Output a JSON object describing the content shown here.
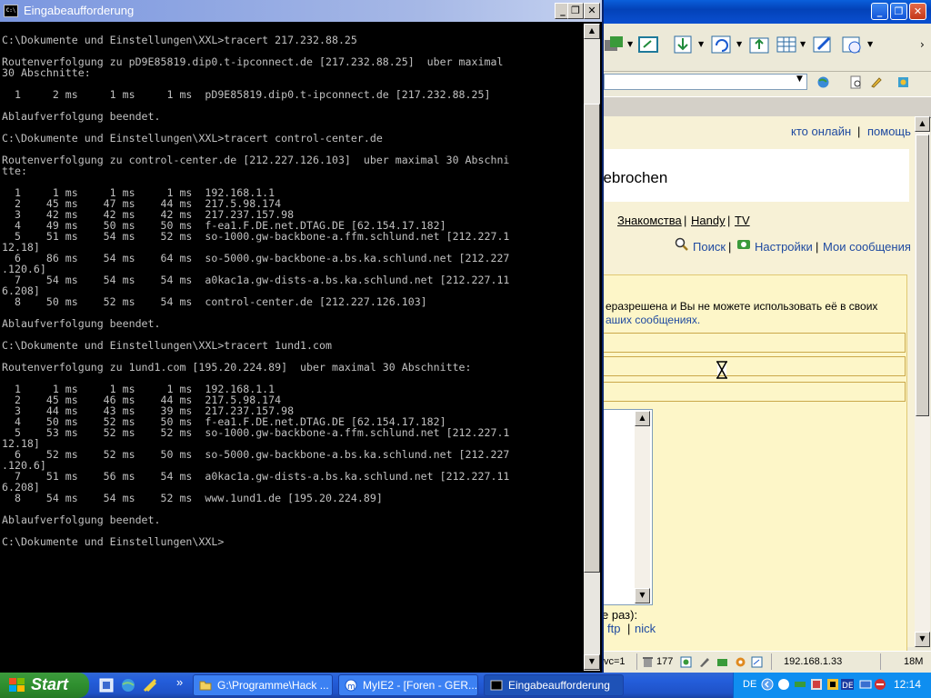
{
  "console": {
    "title": "Eingabeaufforderung",
    "output": "C:\\Dokumente und Einstellungen\\XXL>tracert 217.232.88.25\n\nRoutenverfolgung zu pD9E85819.dip0.t-ipconnect.de [217.232.88.25]  uber maximal\n30 Abschnitte:\n\n  1     2 ms     1 ms     1 ms  pD9E85819.dip0.t-ipconnect.de [217.232.88.25]\n\nAblaufverfolgung beendet.\n\nC:\\Dokumente und Einstellungen\\XXL>tracert control-center.de\n\nRoutenverfolgung zu control-center.de [212.227.126.103]  uber maximal 30 Abschni\ntte:\n\n  1     1 ms     1 ms     1 ms  192.168.1.1\n  2    45 ms    47 ms    44 ms  217.5.98.174\n  3    42 ms    42 ms    42 ms  217.237.157.98\n  4    49 ms    50 ms    50 ms  f-ea1.F.DE.net.DTAG.DE [62.154.17.182]\n  5    51 ms    54 ms    52 ms  so-1000.gw-backbone-a.ffm.schlund.net [212.227.1\n12.18]\n  6    86 ms    54 ms    64 ms  so-5000.gw-backbone-a.bs.ka.schlund.net [212.227\n.120.6]\n  7    54 ms    54 ms    54 ms  a0kac1a.gw-dists-a.bs.ka.schlund.net [212.227.11\n6.208]\n  8    50 ms    52 ms    54 ms  control-center.de [212.227.126.103]\n\nAblaufverfolgung beendet.\n\nC:\\Dokumente und Einstellungen\\XXL>tracert 1und1.com\n\nRoutenverfolgung zu 1und1.com [195.20.224.89]  uber maximal 30 Abschnitte:\n\n  1     1 ms     1 ms     1 ms  192.168.1.1\n  2    45 ms    46 ms    44 ms  217.5.98.174\n  3    44 ms    43 ms    39 ms  217.237.157.98\n  4    50 ms    52 ms    50 ms  f-ea1.F.DE.net.DTAG.DE [62.154.17.182]\n  5    53 ms    52 ms    52 ms  so-1000.gw-backbone-a.ffm.schlund.net [212.227.1\n12.18]\n  6    52 ms    52 ms    50 ms  so-5000.gw-backbone-a.bs.ka.schlund.net [212.227\n.120.6]\n  7    51 ms    56 ms    54 ms  a0kac1a.gw-dists-a.bs.ka.schlund.net [212.227.11\n6.208]\n  8    54 ms    54 ms    52 ms  www.1und1.de [195.20.224.89]\n\nAblaufverfolgung beendet.\n\nC:\\Dokumente und Einstellungen\\XXL>"
  },
  "browser": {
    "top_links": [
      "кто онлайн",
      "помощь"
    ],
    "banner_text": "gebrochen",
    "nav_links": [
      "Знакомства",
      "Handy",
      "TV"
    ],
    "action_links": [
      "Поиск",
      "Настройки",
      "Мои сообщения"
    ],
    "notice_line1": "еразрешена и Вы не можете использовать её в своих",
    "notice_line2": "аших сообщениях.",
    "label_times": "е раз):",
    "bottom_links": [
      "ftp",
      "nick"
    ],
    "status": {
      "text": "vc=1",
      "count": "177",
      "ip": "192.168.1.33",
      "memory": "18M"
    }
  },
  "taskbar": {
    "start_label": "Start",
    "tasks": [
      {
        "label": "G:\\Programme\\Hack ...",
        "icon": "folder-icon"
      },
      {
        "label": "MyIE2 - [Foren - GER...",
        "icon": "myie2-icon"
      },
      {
        "label": "Eingabeaufforderung",
        "icon": "console-icon"
      }
    ],
    "language": "DE",
    "clock": "12:14"
  },
  "colors": {
    "console_bg": "#000000",
    "console_text": "#c0c0c0",
    "page_bg": "#f7f1d6",
    "link": "#1f4aa0",
    "taskbar": "#245edb",
    "start": "#2f8f2f"
  }
}
